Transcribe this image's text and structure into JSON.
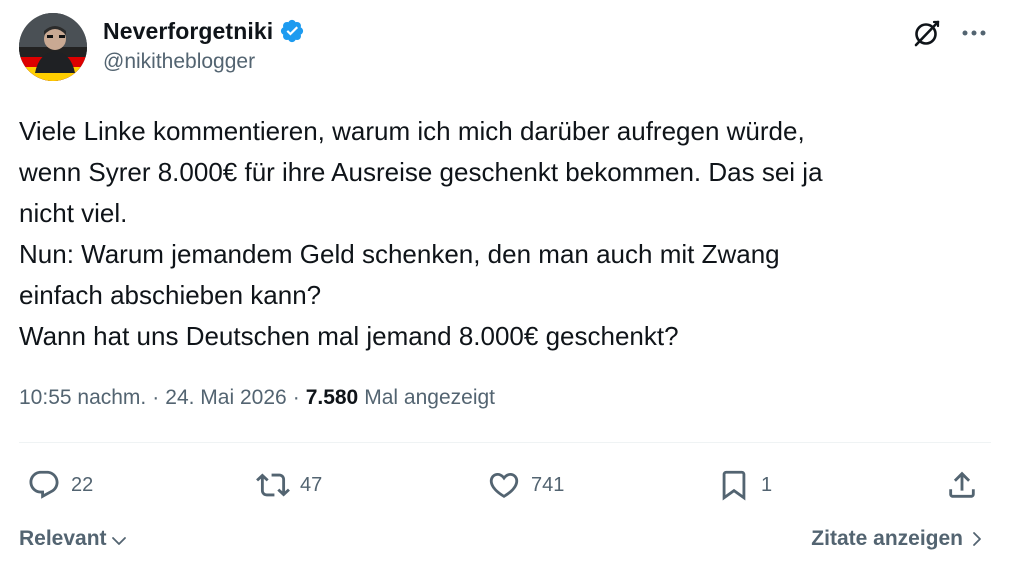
{
  "author": {
    "display_name": "Neverforgetniki",
    "handle": "@nikitheblogger",
    "verified": true
  },
  "tweet": {
    "lines": [
      "Viele Linke kommentieren, warum ich mich darüber aufregen würde,",
      "wenn Syrer 8.000€ für ihre Ausreise geschenkt bekommen. Das sei ja",
      "nicht viel.",
      "Nun: Warum jemandem Geld schenken, den man auch mit Zwang",
      "einfach abschieben kann?",
      "Wann hat uns Deutschen mal jemand 8.000€ geschenkt?"
    ]
  },
  "meta": {
    "time": "10:55 nachm.",
    "separator": "·",
    "date": "24. Mai 2026",
    "views_count": "7.580",
    "views_label": "Mal angezeigt"
  },
  "actions": {
    "replies": "22",
    "retweets": "47",
    "likes": "741",
    "bookmarks": "1"
  },
  "footer": {
    "sort_label": "Relevant",
    "quotes_label": "Zitate anzeigen"
  },
  "icons": {
    "verified": "verified-badge-icon",
    "grok": "grok-icon",
    "more": "more-icon",
    "reply": "reply-icon",
    "retweet": "retweet-icon",
    "like": "heart-icon",
    "bookmark": "bookmark-icon",
    "share": "share-icon"
  },
  "colors": {
    "text_primary": "#0f1419",
    "text_secondary": "#536471",
    "verified_blue": "#1d9bf0",
    "divider": "#eff3f4"
  }
}
